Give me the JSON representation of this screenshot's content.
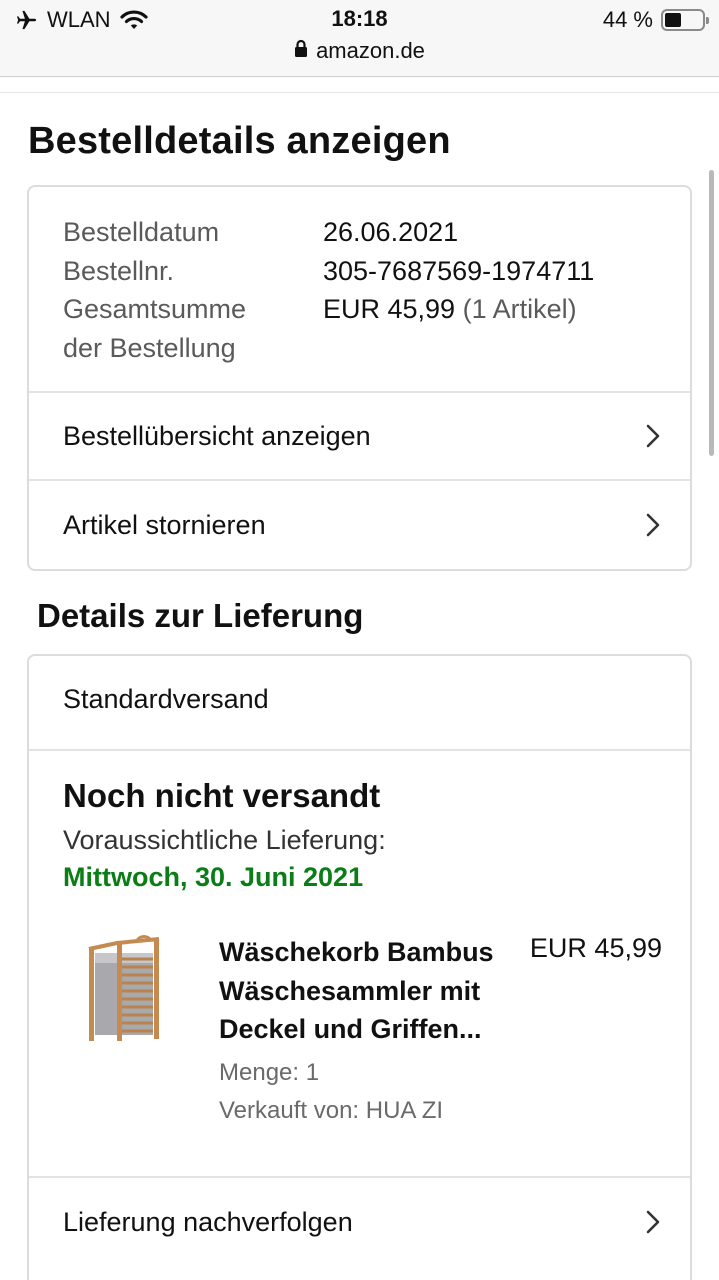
{
  "status_bar": {
    "carrier": "WLAN",
    "time": "18:18",
    "battery": "44 %",
    "battery_level": 0.44
  },
  "url_bar": {
    "domain": "amazon.de",
    "icon": "lock-icon"
  },
  "page": {
    "title": "Bestelldetails anzeigen"
  },
  "order_info": {
    "date_label": "Bestelldatum",
    "date_value": "26.06.2021",
    "number_label": "Bestellnr.",
    "number_value": "305-7687569-1974711",
    "total_label_line1": "Gesamtsumme",
    "total_label_line2": "der Bestellung",
    "total_value": "EUR 45,99",
    "total_items": "(1 Artikel)"
  },
  "order_actions": [
    {
      "label": "Bestellübersicht anzeigen",
      "icon": "chevron-right-icon"
    },
    {
      "label": "Artikel stornieren",
      "icon": "chevron-right-icon"
    }
  ],
  "delivery": {
    "section_title": "Details zur Lieferung",
    "shipping_method": "Standardversand",
    "status": "Noch nicht versandt",
    "expected_label": "Voraussichtliche Lieferung:",
    "expected_date": "Mittwoch, 30. Juni 2021",
    "date_color": "#0a7d16"
  },
  "product": {
    "title_line1": "Wäschekorb Bambus",
    "title_line2": "Wäschesammler mit",
    "title_line3": "Deckel und Griffen...",
    "price": "EUR 45,99",
    "quantity": "Menge: 1",
    "seller": "Verkauft von: HUA ZI"
  },
  "tracking": {
    "label": "Lieferung nachverfolgen",
    "icon": "chevron-right-icon"
  }
}
